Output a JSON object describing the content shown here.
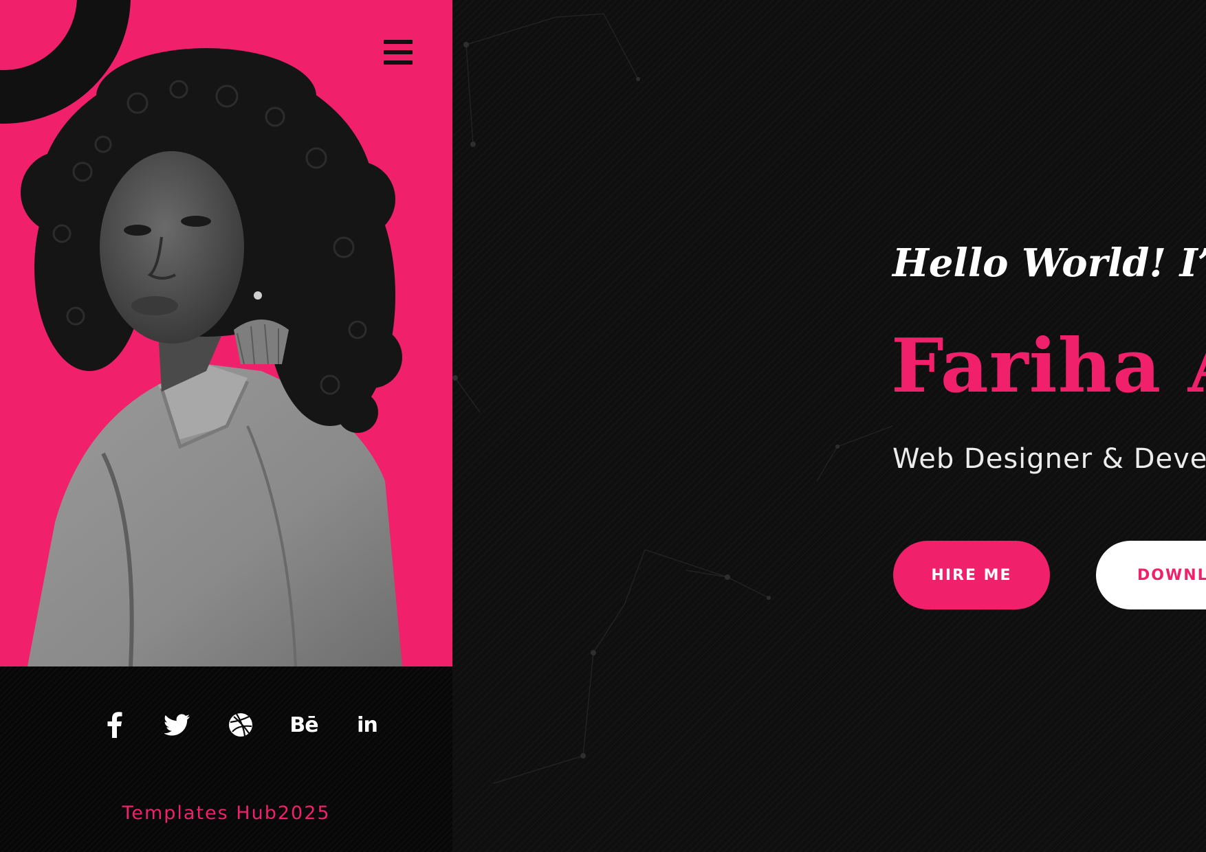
{
  "brand": {
    "accent": "#f1206b",
    "dark": "#0f0f10",
    "text_light": "#ffffff"
  },
  "sidebar": {
    "menu_icon": "hamburger-menu-icon",
    "photo": "black-and-white portrait",
    "social_links": [
      {
        "icon": "facebook-icon"
      },
      {
        "icon": "twitter-icon"
      },
      {
        "icon": "dribbble-icon"
      },
      {
        "icon": "behance-icon",
        "label": "Bē"
      },
      {
        "icon": "linkedin-icon",
        "label": "in"
      }
    ],
    "copyright": "Templates Hub2025"
  },
  "hero": {
    "greeting": "Hello World! I’m",
    "name": "Fariha Ar",
    "role": "Web Designer & Devel",
    "hire_button": "HIRE ME",
    "download_button": "DOWNL"
  }
}
